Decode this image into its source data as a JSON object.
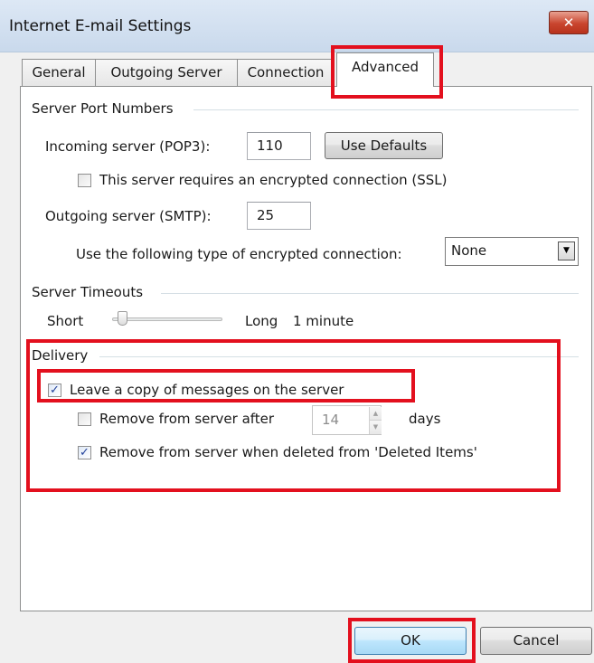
{
  "window": {
    "title": "Internet E-mail Settings",
    "close_glyph": "✕"
  },
  "tabs": [
    {
      "label": "General"
    },
    {
      "label": "Outgoing Server"
    },
    {
      "label": "Connection"
    },
    {
      "label": "Advanced",
      "selected": true
    }
  ],
  "server_ports": {
    "group_label": "Server Port Numbers",
    "incoming_label": "Incoming server (POP3):",
    "incoming_value": "110",
    "use_defaults_label": "Use Defaults",
    "ssl_label": "This server requires an encrypted connection (SSL)",
    "ssl_checked": false,
    "outgoing_label": "Outgoing server (SMTP):",
    "outgoing_value": "25",
    "encryption_label": "Use the following type of encrypted connection:",
    "encryption_value": "None"
  },
  "timeouts": {
    "group_label": "Server Timeouts",
    "short_label": "Short",
    "long_label": "Long",
    "value_label": "1 minute",
    "slider_level": 0.05
  },
  "delivery": {
    "group_label": "Delivery",
    "leave_copy_label": "Leave a copy of messages on the server",
    "leave_copy_checked": true,
    "remove_after_label": "Remove from server after",
    "remove_after_checked": false,
    "remove_after_days": "14",
    "days_label": "days",
    "remove_deleted_label": "Remove from server when deleted from 'Deleted Items'",
    "remove_deleted_checked": true
  },
  "footer": {
    "ok_label": "OK",
    "cancel_label": "Cancel"
  },
  "check_glyph": "✓",
  "dropdown_glyph": "▼",
  "spin_up_glyph": "▲",
  "spin_down_glyph": "▼",
  "colors": {
    "highlight": "#e3101e",
    "check": "#21409a"
  }
}
